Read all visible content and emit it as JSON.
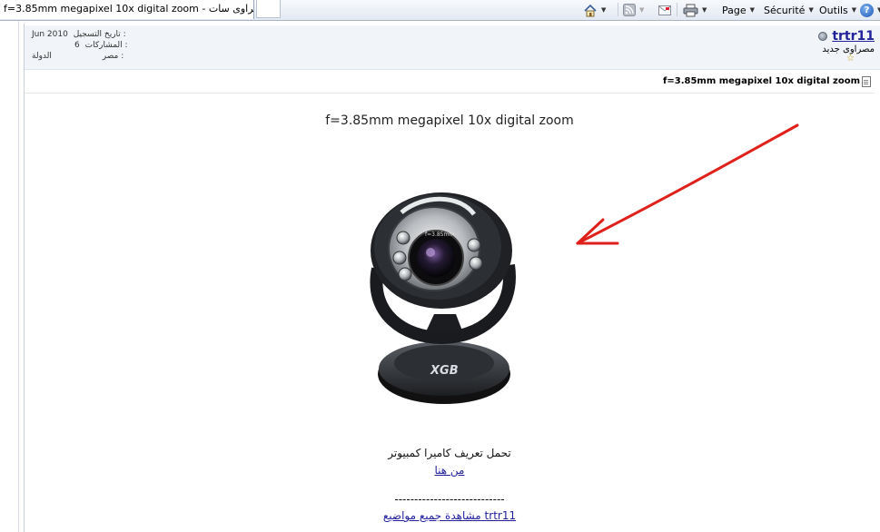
{
  "browser": {
    "tab_title": "f=3.85mm megapixel 10x digital zoom - مصراوى سات",
    "commands": {
      "page": "Page",
      "security": "Sécurité",
      "tools": "Outils",
      "help": "?"
    }
  },
  "post": {
    "user": {
      "name": "trtr11",
      "title": "مصراوى جديد",
      "stars": "☆"
    },
    "registration": {
      "date_label": "تاريخ التسجيل :",
      "date_value": "Jun 2010",
      "posts_label": "المشاركات :",
      "posts_value": "6",
      "country_label": "الدولة :",
      "country_value": "مصر"
    },
    "title": "f=3.85mm megapixel 10x digital zoom",
    "headline": "f=3.85mm megapixel 10x digital zoom",
    "image": {
      "lens_text": "f=3.85mm",
      "brand": "XGB"
    },
    "caption": "تحمل تعريف كاميرا كمبيوتر",
    "download_link": "من هنا",
    "separator": "----------------------------",
    "all_topics_link": "مشاهدة جميع مواضيع trtr11"
  },
  "colors": {
    "link": "#22229c",
    "arrow": "#e0201b",
    "header_bg": "#f1f4f8"
  }
}
